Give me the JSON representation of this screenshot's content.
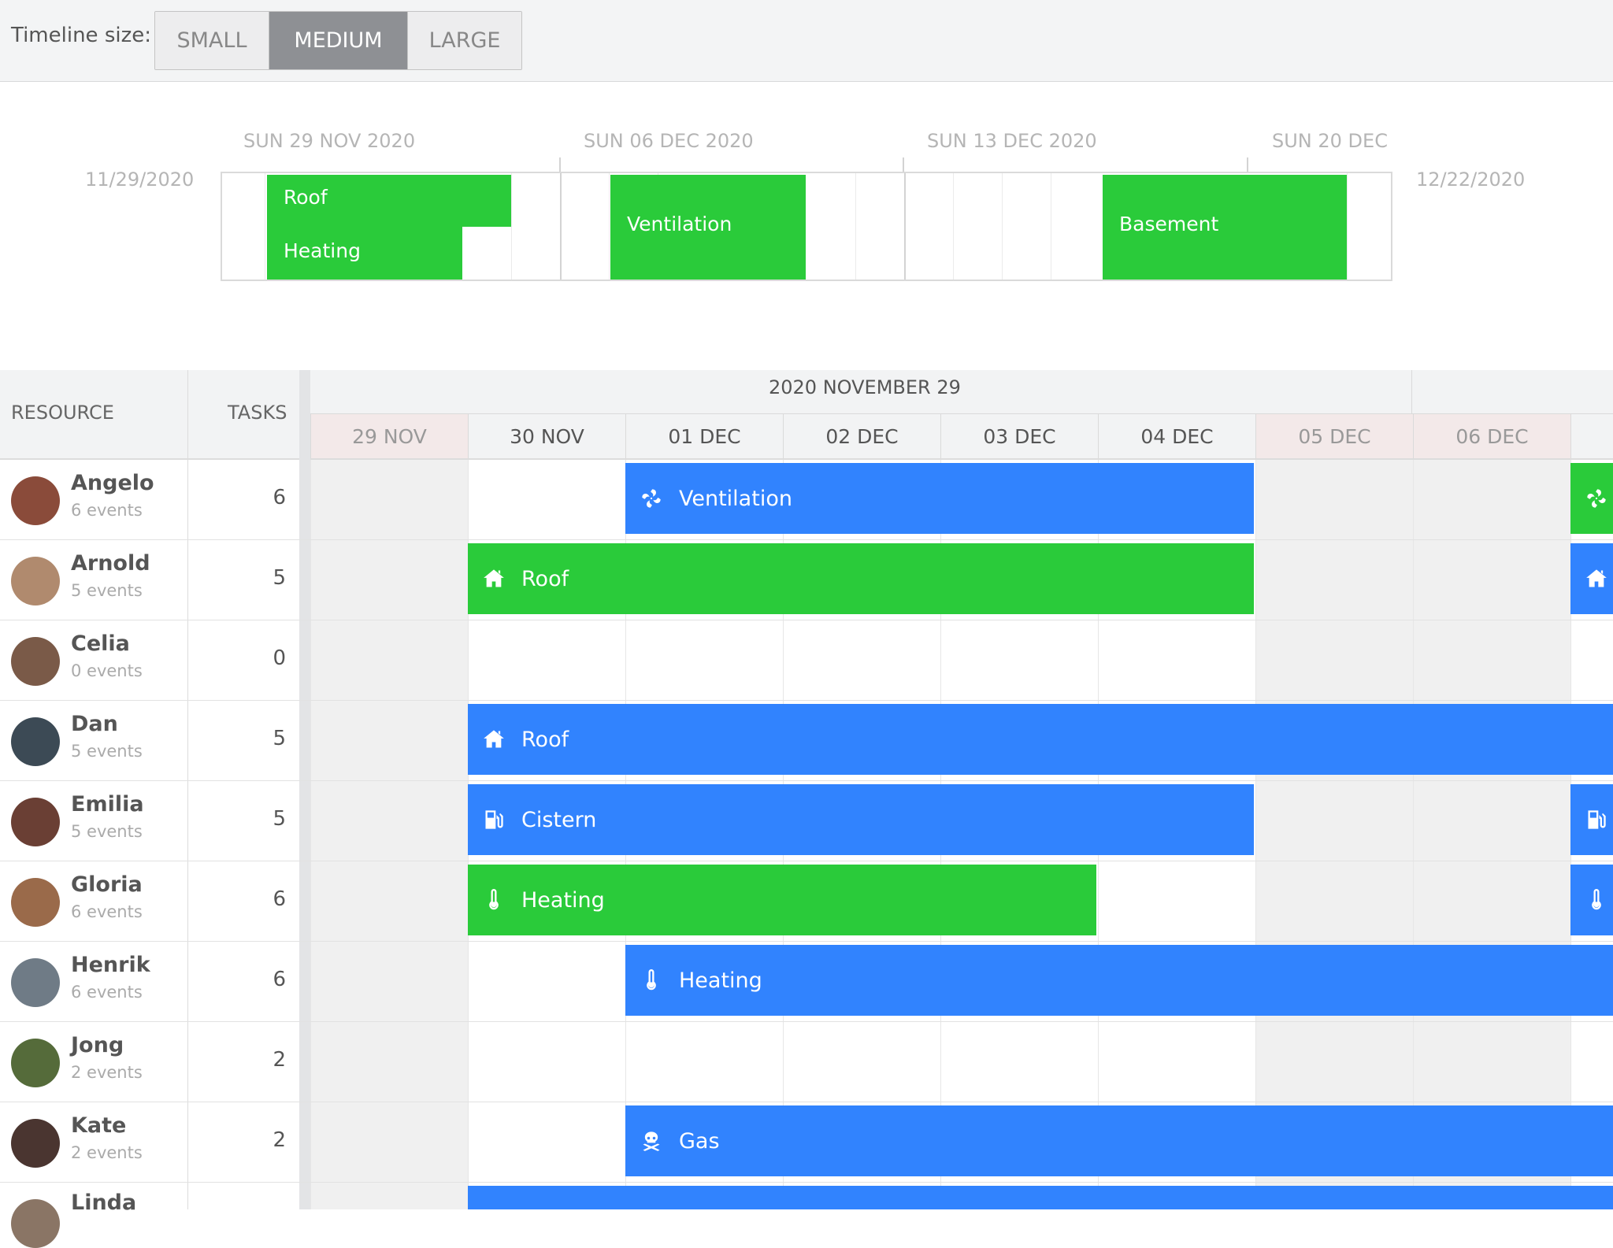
{
  "toolbar": {
    "label": "Timeline size:",
    "options": [
      "SMALL",
      "MEDIUM",
      "LARGE"
    ],
    "selected": "MEDIUM"
  },
  "overview": {
    "start_date": "11/29/2020",
    "end_date": "12/22/2020",
    "weeks": [
      "SUN 29 NOV 2020",
      "SUN 06 DEC 2020",
      "SUN 13 DEC 2020",
      "SUN 20 DEC"
    ],
    "events": [
      "Roof",
      "Heating",
      "Ventilation",
      "Basement"
    ]
  },
  "grid": {
    "resource_header": "RESOURCE",
    "tasks_header": "TASKS",
    "month_header": "2020 NOVEMBER 29",
    "days": [
      "29 NOV",
      "30 NOV",
      "01 DEC",
      "02 DEC",
      "03 DEC",
      "04 DEC",
      "05 DEC",
      "06 DEC"
    ],
    "rows": [
      {
        "name": "Angelo",
        "events": "6 events",
        "tasks": "6",
        "avatar_color": "#8a4b3a"
      },
      {
        "name": "Arnold",
        "events": "5 events",
        "tasks": "5",
        "avatar_color": "#b08a6e"
      },
      {
        "name": "Celia",
        "events": "0 events",
        "tasks": "0",
        "avatar_color": "#7a5a48"
      },
      {
        "name": "Dan",
        "events": "5 events",
        "tasks": "5",
        "avatar_color": "#3c4a55"
      },
      {
        "name": "Emilia",
        "events": "5 events",
        "tasks": "5",
        "avatar_color": "#6a3f34"
      },
      {
        "name": "Gloria",
        "events": "6 events",
        "tasks": "6",
        "avatar_color": "#9a6a4a"
      },
      {
        "name": "Henrik",
        "events": "6 events",
        "tasks": "6",
        "avatar_color": "#6f7b86"
      },
      {
        "name": "Jong",
        "events": "2 events",
        "tasks": "2",
        "avatar_color": "#556b3a"
      },
      {
        "name": "Kate",
        "events": "2 events",
        "tasks": "2",
        "avatar_color": "#4a3530"
      },
      {
        "name": "Linda",
        "events": "",
        "tasks": "",
        "avatar_color": "#8a7565"
      }
    ],
    "events": [
      {
        "label": "Ventilation",
        "icon": "fan-icon"
      },
      {
        "label": "",
        "icon": "fan-icon"
      },
      {
        "label": "Roof",
        "icon": "house-icon"
      },
      {
        "label": "",
        "icon": "house-icon"
      },
      {
        "label": "Roof",
        "icon": "house-icon"
      },
      {
        "label": "Cistern",
        "icon": "gas-pump-icon"
      },
      {
        "label": "",
        "icon": "gas-pump-icon"
      },
      {
        "label": "Heating",
        "icon": "thermometer-icon"
      },
      {
        "label": "",
        "icon": "thermometer-icon"
      },
      {
        "label": "Heating",
        "icon": "thermometer-icon"
      },
      {
        "label": "Gas",
        "icon": "skull-crossbones-icon"
      },
      {
        "label": "",
        "icon": ""
      }
    ]
  },
  "colors": {
    "green": "#2acb3a",
    "blue": "#3183fe",
    "active_button": "#8e9094"
  }
}
